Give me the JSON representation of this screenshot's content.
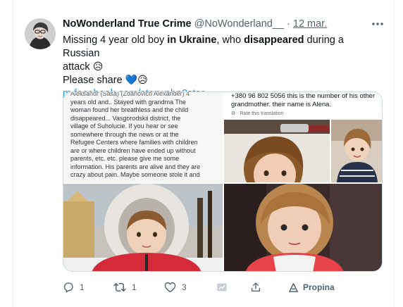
{
  "tweet": {
    "author_name": "NoWonderland True Crime",
    "author_handle": "@NoWonderland__",
    "separator": "·",
    "date": "12 mar.",
    "text_line1_a": "Missing 4 year old boy ",
    "text_line1_b": "in Ukraine",
    "text_line1_c": ", who ",
    "text_line1_d": "disappeared",
    "text_line1_e": " during a Russian",
    "text_line2": "attack",
    "text_line3": "Please share",
    "link_text": "m.facebook.com/story.php?stor..."
  },
  "media": {
    "screenshot_text": [
      "Aleksandr (Sasa) (Zdanovich Alexander) 4",
      "years old and.. Stayed with grandma The",
      "woman found her breathless and the child",
      "disappeared... Vasgorodskii district, the",
      "village of Suholucie. If you hear or see",
      "somewhere through the news or at the",
      "Refugee Centers where families with children",
      "are or where children have ended up without",
      "parents, etc. etc. please give me some",
      "information. His parents are alive and they are",
      "crazy about pain. Maybe someone stole it and"
    ],
    "contact_note": "+380 96 802 5056 this is the number of his other grandmother. their name is Alena.",
    "rate_translation": "Rate this translation"
  },
  "actions": {
    "reply_count": "1",
    "retweet_count": "1",
    "like_count": "3",
    "translate_label": "Propina"
  },
  "icons": {
    "more": "more-dots-icon",
    "reply": "reply-icon",
    "retweet": "retweet-icon",
    "like": "heart-icon",
    "stats": "analytics-icon",
    "share": "share-icon",
    "translate": "translate-icon"
  },
  "colors": {
    "link": "#1d9bf0",
    "secondary_text": "#536471",
    "primary_text": "#0f1419",
    "border": "#cfd9de"
  }
}
